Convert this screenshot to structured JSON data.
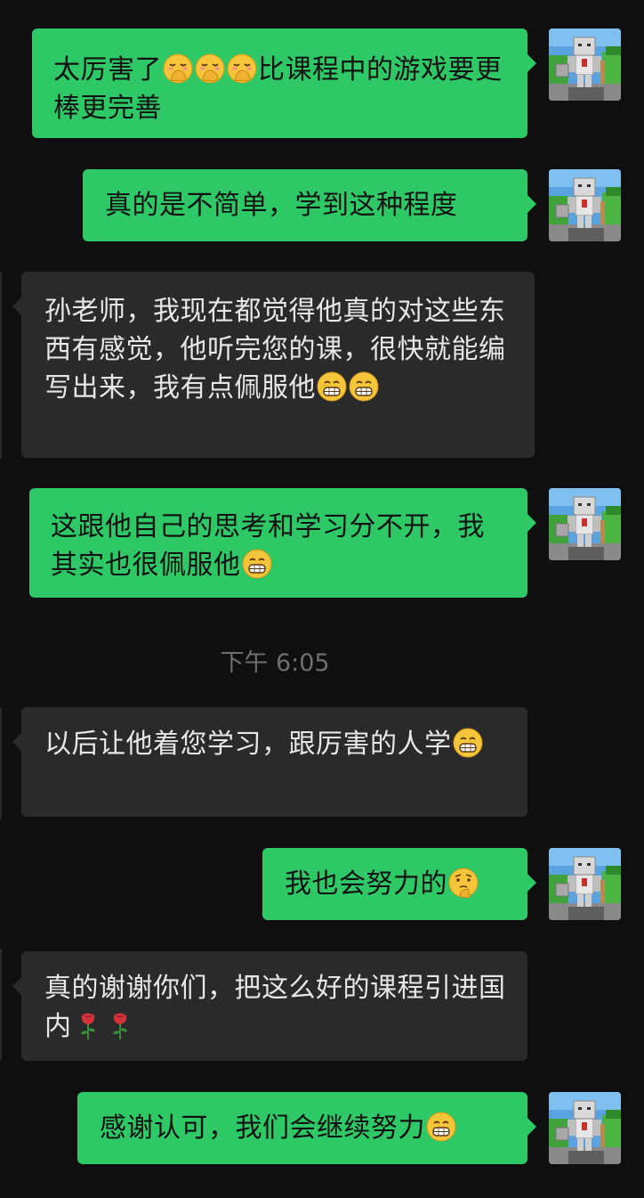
{
  "messages": [
    {
      "id": "m1",
      "side": "sent",
      "parts": [
        {
          "t": "text",
          "v": "太厉害了"
        },
        {
          "t": "emoji",
          "v": "hand-over-mouth-emoji"
        },
        {
          "t": "emoji",
          "v": "hand-over-mouth-emoji"
        },
        {
          "t": "emoji",
          "v": "hand-over-mouth-emoji"
        },
        {
          "t": "text",
          "v": "比课程中的游戏要更棒更完善"
        }
      ]
    },
    {
      "id": "m2",
      "side": "sent",
      "parts": [
        {
          "t": "text",
          "v": "真的是不简单，学到这种程度"
        }
      ]
    },
    {
      "id": "m3",
      "side": "recv",
      "parts": [
        {
          "t": "text",
          "v": "孙老师，我现在都觉得他真的对这些东西有感觉，他听完您的课，很快就能编写出来，我有点佩服他"
        },
        {
          "t": "emoji",
          "v": "grin-emoji"
        },
        {
          "t": "emoji",
          "v": "grin-emoji"
        }
      ]
    },
    {
      "id": "m4",
      "side": "sent",
      "parts": [
        {
          "t": "text",
          "v": "这跟他自己的思考和学习分不开，我其实也很佩服他"
        },
        {
          "t": "emoji",
          "v": "grin-emoji"
        }
      ]
    },
    {
      "id": "m5",
      "side": "recv",
      "parts": [
        {
          "t": "text",
          "v": "以后让他着您学习，跟厉害的人学"
        },
        {
          "t": "emoji",
          "v": "grin-emoji"
        }
      ]
    },
    {
      "id": "m6",
      "side": "sent",
      "parts": [
        {
          "t": "text",
          "v": "我也会努力的"
        },
        {
          "t": "emoji",
          "v": "thinking-emoji"
        }
      ]
    },
    {
      "id": "m7",
      "side": "recv",
      "parts": [
        {
          "t": "text",
          "v": "真的谢谢你们，把这么好的课程引进国内"
        },
        {
          "t": "emoji",
          "v": "rose-emoji"
        },
        {
          "t": "emoji",
          "v": "rose-emoji"
        }
      ]
    },
    {
      "id": "m8",
      "side": "sent",
      "parts": [
        {
          "t": "text",
          "v": "感谢认可，我们会继续努力"
        },
        {
          "t": "emoji",
          "v": "grin-emoji"
        }
      ]
    }
  ],
  "timestamp": "下午 6:05",
  "avatar_icon": "robot-avatar-icon",
  "colors": {
    "background": "#0f0f0f",
    "sent_bubble": "#2ec866",
    "recv_bubble": "#2a2a2a",
    "timestamp_text": "#6e6e6e"
  }
}
